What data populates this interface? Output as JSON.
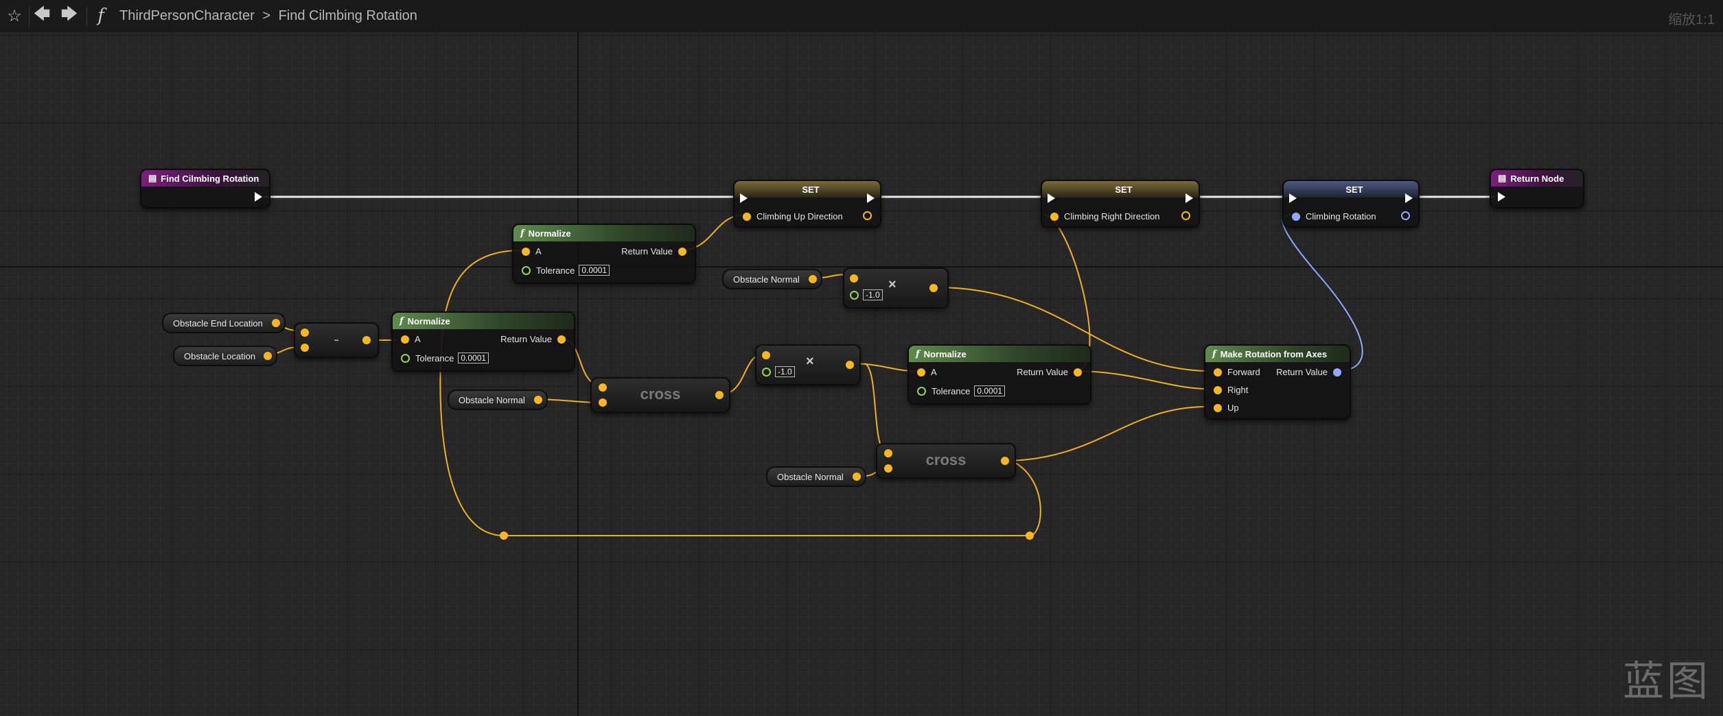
{
  "toolbar": {
    "icons": [
      "star-icon",
      "back-arrow-icon",
      "forward-arrow-icon",
      "function-icon"
    ],
    "breadcrumb_parent": "ThirdPersonCharacter",
    "breadcrumb_separator": ">",
    "breadcrumb_current": "Find Cilmbing Rotation",
    "zoom": "缩放1:1"
  },
  "watermark": "蓝图",
  "nodes": {
    "entry": {
      "title": "Find Cilmbing Rotation"
    },
    "return": {
      "title": "Return Node"
    },
    "set1": {
      "title": "SET",
      "pin": "Climbing Up Direction"
    },
    "set2": {
      "title": "SET",
      "pin": "Climbing Right Direction"
    },
    "set3": {
      "title": "SET",
      "pin": "Climbing Rotation"
    },
    "normalize_top": {
      "title": "Normalize",
      "in": "A",
      "out": "Return Value",
      "tol_label": "Tolerance",
      "tol": "0.0001"
    },
    "normalize_mid": {
      "title": "Normalize",
      "in": "A",
      "out": "Return Value",
      "tol_label": "Tolerance",
      "tol": "0.0001"
    },
    "normalize_right": {
      "title": "Normalize",
      "in": "A",
      "out": "Return Value",
      "tol_label": "Tolerance",
      "tol": "0.0001"
    },
    "make_rot": {
      "title": "Make Rotation from Axes",
      "forward": "Forward",
      "right": "Right",
      "up": "Up",
      "out": "Return Value"
    },
    "subtract": {
      "symbol": "-"
    },
    "mult1": {
      "value": "-1.0",
      "symbol": "×"
    },
    "mult2": {
      "value": "-1.0",
      "symbol": "×"
    },
    "cross1": {
      "label": "cross"
    },
    "cross2": {
      "label": "cross"
    }
  },
  "variables": {
    "obstacle_end_location": "Obstacle End Location",
    "obstacle_location": "Obstacle Location",
    "obstacle_normal_1": "Obstacle Normal",
    "obstacle_normal_2": "Obstacle Normal",
    "obstacle_normal_3": "Obstacle Normal"
  },
  "colors": {
    "background": "#262626",
    "vector_wire": "#f7b81e",
    "rotator_wire": "#93a8ff",
    "exec_wire": "#ffffff",
    "event_header": "#7b1f7f",
    "function_header": "#5f8a4e"
  }
}
